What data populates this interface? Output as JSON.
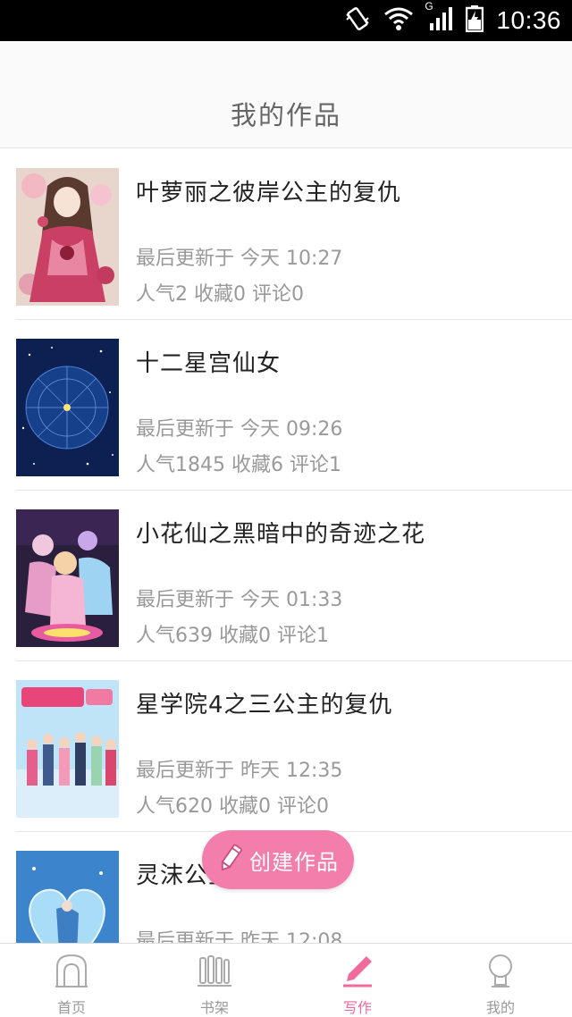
{
  "status_bar": {
    "time": "10:36",
    "signal_letter": "G",
    "icons": [
      "vibrate-icon",
      "wifi-icon",
      "signal-icon",
      "battery-charging-icon"
    ]
  },
  "header": {
    "title": "我的作品"
  },
  "works": [
    {
      "title": "叶萝丽之彼岸公主的复仇",
      "updated": "最后更新于 今天 10:27",
      "stats": "人气2 收藏0 评论0",
      "cover": "anime-girl-cover"
    },
    {
      "title": "十二星宫仙女",
      "updated": "最后更新于 今天 09:26",
      "stats": "人气1845 收藏6 评论1",
      "cover": "zodiac-chart-cover"
    },
    {
      "title": "小花仙之黑暗中的奇迹之花",
      "updated": "最后更新于 今天 01:33",
      "stats": "人气639 收藏0 评论1",
      "cover": "flower-fairy-cover"
    },
    {
      "title": "星学院4之三公主的复仇",
      "updated": "最后更新于 昨天 12:35",
      "stats": "人气620 收藏0 评论0",
      "cover": "star-academy-cover"
    },
    {
      "title": "灵沫公主之恋爱",
      "updated": "最后更新于 昨天 12:08",
      "stats": "",
      "cover": "crystal-heart-cover"
    }
  ],
  "fab": {
    "label": "创建作品",
    "icon": "pencil-icon"
  },
  "bottom_nav": {
    "items": [
      {
        "label": "首页",
        "icon": "home-icon",
        "active": false
      },
      {
        "label": "书架",
        "icon": "bookshelf-icon",
        "active": false
      },
      {
        "label": "写作",
        "icon": "pencil-icon",
        "active": true
      },
      {
        "label": "我的",
        "icon": "profile-icon",
        "active": false
      }
    ]
  },
  "colors": {
    "accent": "#f06a9b",
    "fab": "#f47eab",
    "text_muted": "#999999"
  }
}
